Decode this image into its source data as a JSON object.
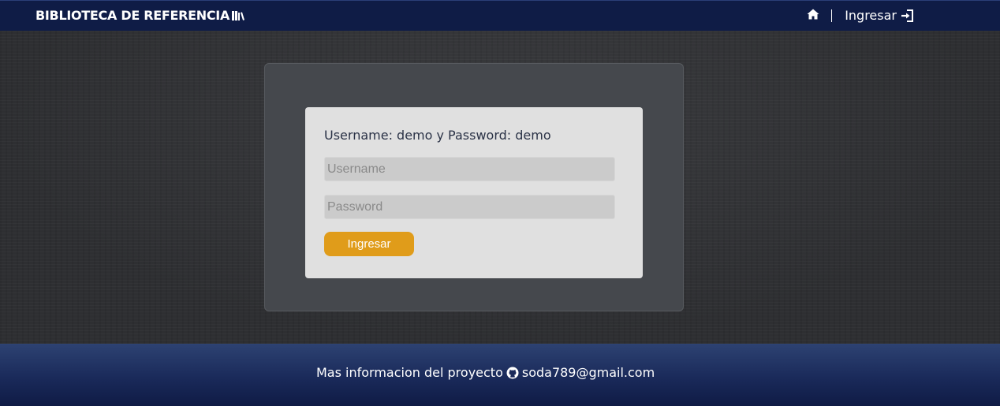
{
  "header": {
    "brand_title": "BIBLIOTECA DE REFERENCIA",
    "brand_icon": "books-icon",
    "home_icon": "home-icon",
    "login_label": "Ingresar",
    "login_icon": "sign-in-icon"
  },
  "login": {
    "hint": "Username: demo y Password: demo",
    "username": {
      "placeholder": "Username",
      "value": ""
    },
    "password": {
      "placeholder": "Password",
      "value": ""
    },
    "submit_label": "Ingresar"
  },
  "footer": {
    "text": "Mas informacion del proyecto",
    "github_icon": "github-icon",
    "email": "soda789@gmail.com"
  },
  "colors": {
    "navbar": "#0f1c46",
    "accent_button": "#e09c1a",
    "card_bg": "#e0e0e0",
    "panel_bg": "#45484d"
  }
}
